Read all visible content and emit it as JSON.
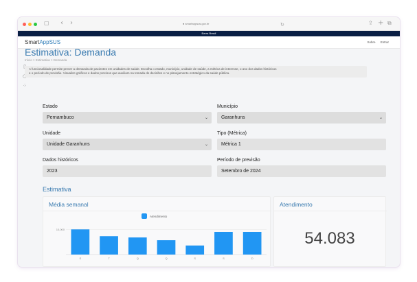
{
  "browser": {
    "url": "smartappsus.gov.br",
    "nav_back": "‹",
    "nav_forward": "›",
    "sidebar_toggle": "▢",
    "reload": "↻",
    "share": "⇪",
    "new_tab": "+",
    "tabs": "⧉",
    "colors": {
      "close": "#ff5f57",
      "minimize": "#febc2e",
      "maximize": "#28c840"
    }
  },
  "gov_bar": {
    "label": "Barra Brasil",
    "color": "#0a1f44"
  },
  "header": {
    "logo_prefix": "Smart",
    "logo_accent": "AppSUS",
    "nav": [
      "Sobre",
      "Entrar"
    ]
  },
  "sidebar": {
    "icons": [
      "book-icon",
      "clock-icon",
      "grid-icon"
    ],
    "glyphs": [
      "▯",
      "◔",
      "⁘"
    ]
  },
  "page": {
    "title": "Estimativa: Demanda",
    "breadcrumb": "Início > Estimativa > Demanda",
    "description_line1": "A funcionalidade permite prever a demanda de pacientes em unidades de saúde. Escolha o estado, município, unidade de saúde, a métrica de interesse, o ano dos dados históricos",
    "description_line2": "e o período de previsão. Visualize gráficos e dados precisos que auxiliam na tomada de decisões e no planejamento estratégico da saúde pública."
  },
  "form": {
    "estado": {
      "label": "Estado",
      "value": "Pernambuco"
    },
    "municipio": {
      "label": "Município",
      "value": "Garanhuns"
    },
    "unidade": {
      "label": "Unidade",
      "value": "Unidade Garanhuns"
    },
    "tipo": {
      "label": "Tipo (Métrica)",
      "value": "Métrica 1"
    },
    "dados": {
      "label": "Dados históricos",
      "value": "2023"
    },
    "periodo": {
      "label": "Período de previsão",
      "value": "Setembro de 2024"
    },
    "chevron": "⌄"
  },
  "estimativa": {
    "section_title": "Estimativa",
    "weekly_card_title": "Média semanal",
    "attendance_card_title": "Atendimento",
    "attendance_value": "54.083"
  },
  "chart_data": {
    "type": "bar",
    "categories": [
      "S",
      "T",
      "Q",
      "Q",
      "S",
      "S",
      "D"
    ],
    "series": [
      {
        "name": "Atendimento",
        "values": [
          10000,
          7300,
          6800,
          5700,
          3600,
          9000,
          9000
        ],
        "color": "#2196f3"
      }
    ],
    "y_tick_labels": [
      "10,000"
    ],
    "ylim": [
      0,
      12000
    ],
    "legend": "top-center"
  }
}
